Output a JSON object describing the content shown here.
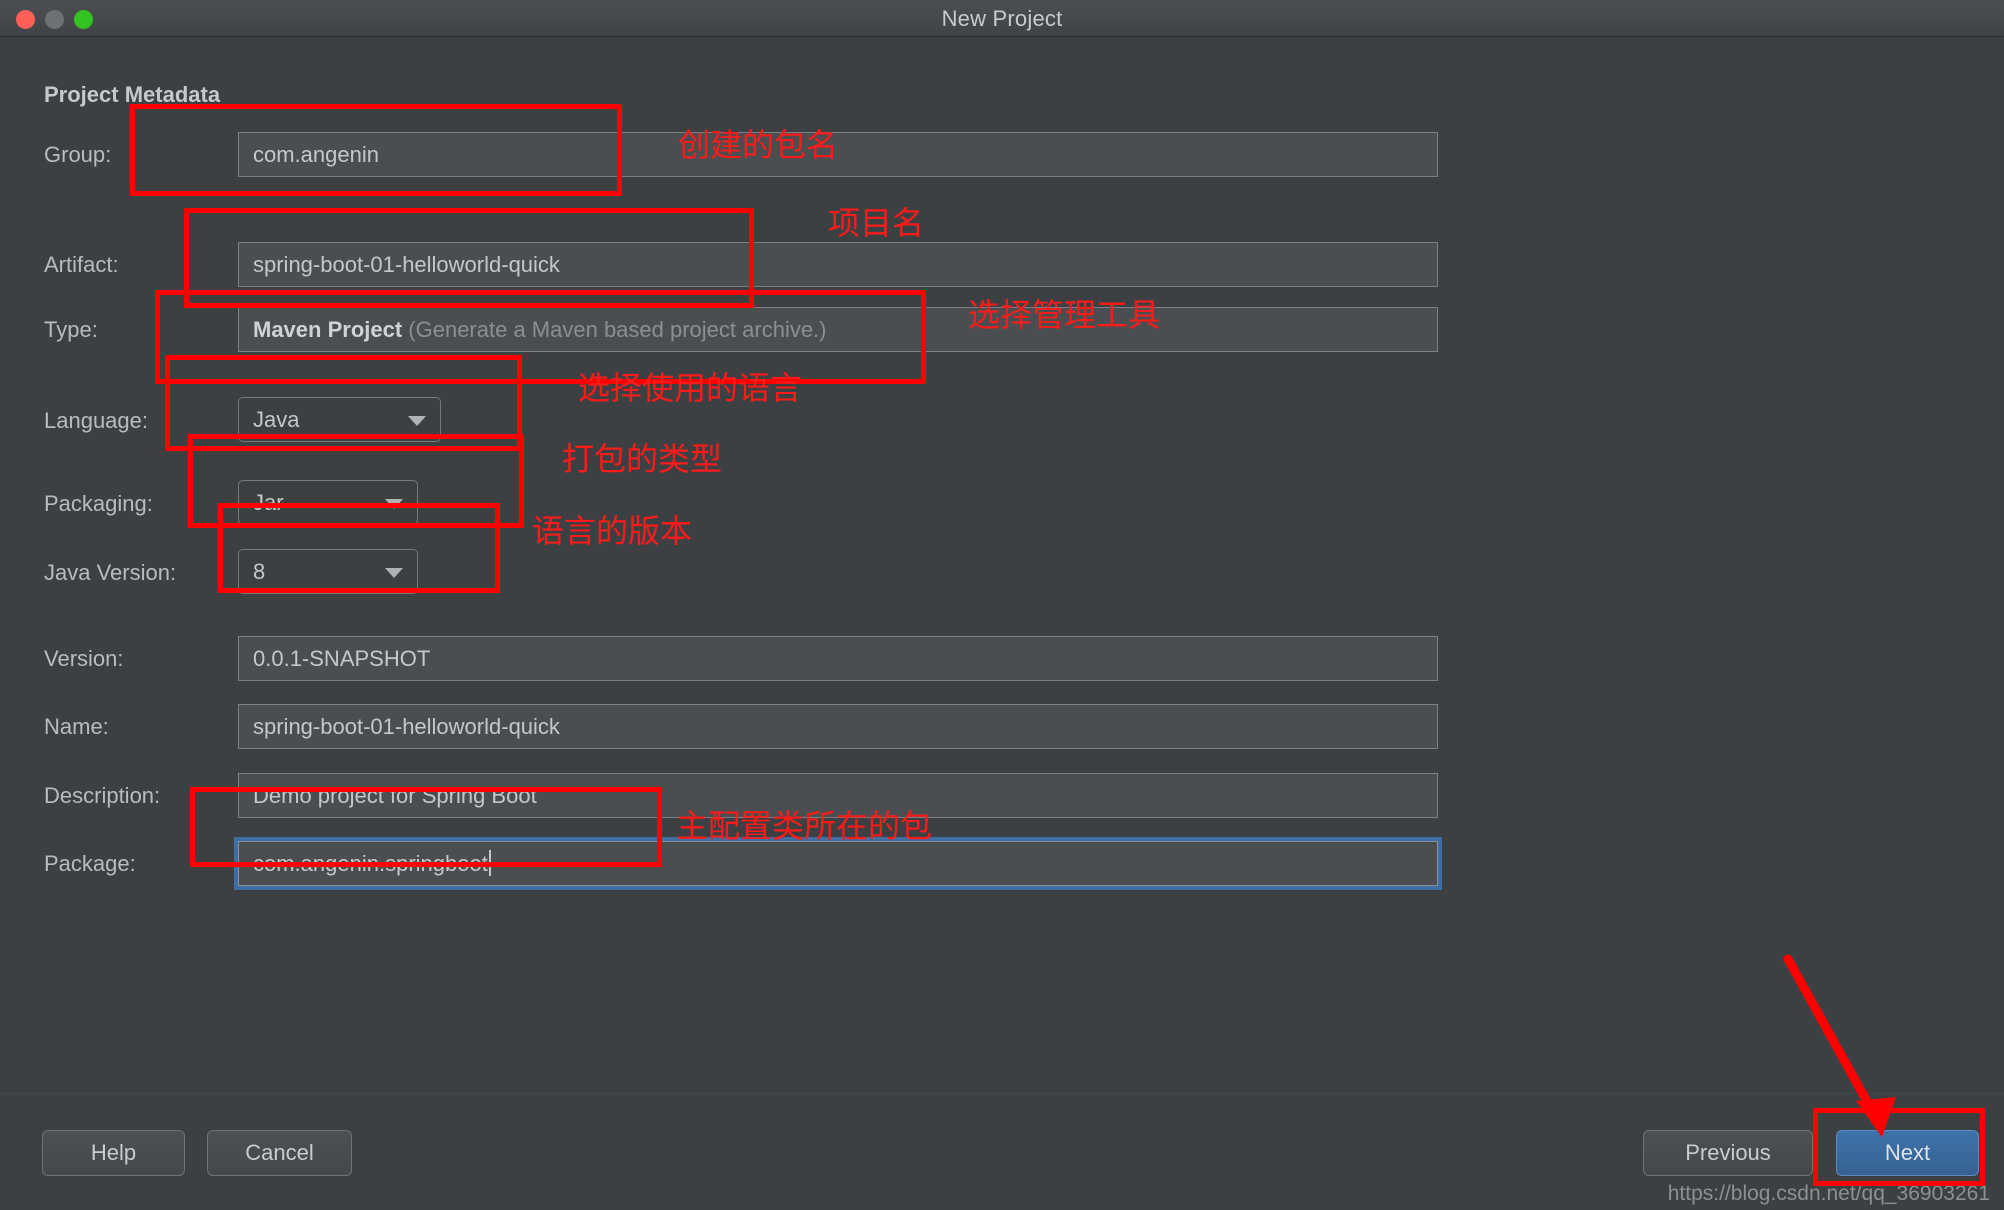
{
  "window": {
    "title": "New Project",
    "traffic_lights": [
      "close-button",
      "minimize-button",
      "maximize-button"
    ]
  },
  "section": {
    "title": "Project Metadata"
  },
  "form": {
    "rows": [
      {
        "key": "group",
        "label": "Group:",
        "value": "com.angenin",
        "control": "text"
      },
      {
        "key": "artifact",
        "label": "Artifact:",
        "value": "spring-boot-01-helloworld-quick",
        "control": "text"
      },
      {
        "key": "type",
        "label": "Type:",
        "value": "Maven Project",
        "value_suffix": " (Generate a Maven based project archive.)",
        "control": "text"
      },
      {
        "key": "language",
        "label": "Language:",
        "value": "Java",
        "control": "combo"
      },
      {
        "key": "packaging",
        "label": "Packaging:",
        "value": "Jar",
        "control": "combo"
      },
      {
        "key": "javaversion",
        "label": "Java Version:",
        "value": "8",
        "control": "combo"
      },
      {
        "key": "version",
        "label": "Version:",
        "value": "0.0.1-SNAPSHOT",
        "control": "text"
      },
      {
        "key": "name",
        "label": "Name:",
        "value": "spring-boot-01-helloworld-quick",
        "control": "text"
      },
      {
        "key": "description",
        "label": "Description:",
        "value": "Demo project for Spring Boot",
        "control": "text"
      },
      {
        "key": "package",
        "label": "Package:",
        "value": "com.angenin.springboot",
        "control": "text",
        "focused": true
      }
    ]
  },
  "buttons": {
    "help": "Help",
    "cancel": "Cancel",
    "previous": "Previous",
    "next": "Next"
  },
  "annotations": {
    "group_note": "创建的包名",
    "artifact_note": "项目名",
    "type_note": "选择管理工具",
    "language_note": "选择使用的语言",
    "packaging_note": "打包的类型",
    "javaversion_note": "语言的版本",
    "package_note": "主配置类所在的包"
  },
  "watermark": "https://blog.csdn.net/qq_36903261",
  "colors": {
    "background": "#3c4043",
    "field_bg": "#4a4e51",
    "annotation": "#ff0000",
    "accent_blue": "#3f72ab",
    "focus_ring": "#3f6ea3"
  }
}
